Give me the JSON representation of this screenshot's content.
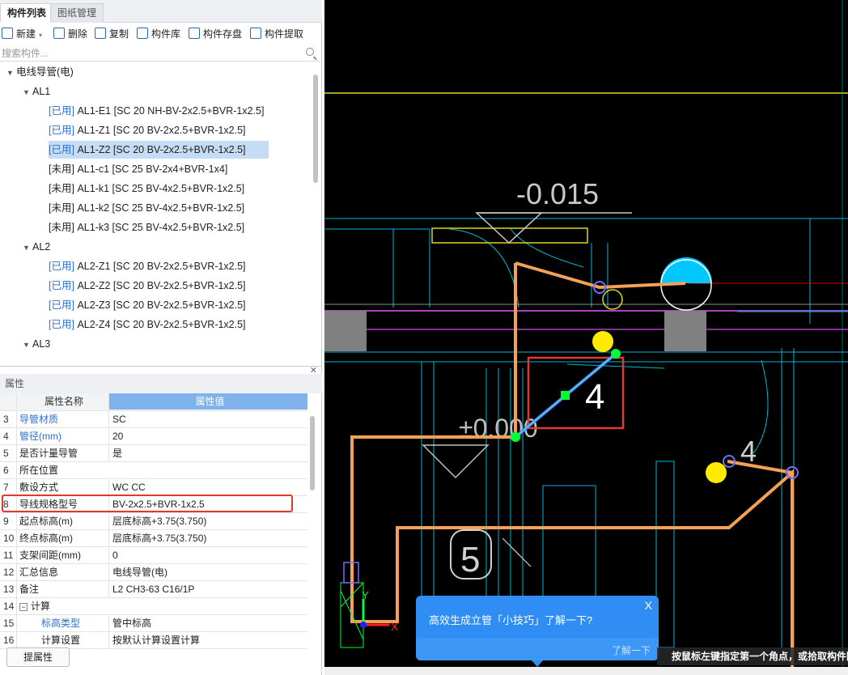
{
  "tabs": [
    "构件列表",
    "图纸管理"
  ],
  "toolbar": {
    "new": "新建",
    "delete": "删除",
    "copy": "复制",
    "library": "构件库",
    "save": "构件存盘",
    "extract": "构件提取"
  },
  "search": {
    "placeholder": "搜索构件..."
  },
  "tree": {
    "root": "电线导管(电)",
    "groups": [
      {
        "name": "AL1",
        "items": [
          {
            "tag": "[已用]",
            "text": "AL1-E1 [SC 20 NH-BV-2x2.5+BVR-1x2.5]"
          },
          {
            "tag": "[已用]",
            "text": "AL1-Z1 [SC 20 BV-2x2.5+BVR-1x2.5]"
          },
          {
            "tag": "[已用]",
            "text": "AL1-Z2 [SC 20 BV-2x2.5+BVR-1x2.5]"
          },
          {
            "tag": "[未用]",
            "text": "AL1-c1 [SC 25 BV-2x4+BVR-1x4]"
          },
          {
            "tag": "[未用]",
            "text": "AL1-k1 [SC 25 BV-4x2.5+BVR-1x2.5]"
          },
          {
            "tag": "[未用]",
            "text": "AL1-k2 [SC 25 BV-4x2.5+BVR-1x2.5]"
          },
          {
            "tag": "[未用]",
            "text": "AL1-k3 [SC 25 BV-4x2.5+BVR-1x2.5]"
          }
        ]
      },
      {
        "name": "AL2",
        "items": [
          {
            "tag": "[已用]",
            "text": "AL2-Z1 [SC 20 BV-2x2.5+BVR-1x2.5]"
          },
          {
            "tag": "[已用]",
            "text": "AL2-Z2 [SC 20 BV-2x2.5+BVR-1x2.5]"
          },
          {
            "tag": "[已用]",
            "text": "AL2-Z3 [SC 20 BV-2x2.5+BVR-1x2.5]"
          },
          {
            "tag": "[已用]",
            "text": "AL2-Z4 [SC 20 BV-2x2.5+BVR-1x2.5]"
          }
        ]
      },
      {
        "name": "AL3",
        "items": []
      }
    ]
  },
  "props": {
    "title": "属性",
    "col_name": "属性名称",
    "col_value": "属性值",
    "rows": [
      {
        "n": "3",
        "k": "导管材质",
        "v": "SC",
        "blue": true
      },
      {
        "n": "4",
        "k": "管径(mm)",
        "v": "20",
        "blue": true
      },
      {
        "n": "5",
        "k": "是否计量导管",
        "v": "是",
        "blue": false
      },
      {
        "n": "6",
        "k": "所在位置",
        "v": "",
        "blue": false
      },
      {
        "n": "7",
        "k": "敷设方式",
        "v": "WC CC",
        "blue": false
      },
      {
        "n": "8",
        "k": "导线规格型号",
        "v": "BV-2x2.5+BVR-1x2.5",
        "blue": false
      },
      {
        "n": "9",
        "k": "起点标高(m)",
        "v": "层底标高+3.75(3.750)",
        "blue": false
      },
      {
        "n": "10",
        "k": "终点标高(m)",
        "v": "层底标高+3.75(3.750)",
        "blue": false
      },
      {
        "n": "11",
        "k": "支架间距(mm)",
        "v": "0",
        "blue": false
      },
      {
        "n": "12",
        "k": "汇总信息",
        "v": "电线导管(电)",
        "blue": false
      },
      {
        "n": "13",
        "k": "备注",
        "v": "L2 CH3-63 C16/1P",
        "blue": false
      },
      {
        "n": "14",
        "k": "计算",
        "v": "",
        "blue": false,
        "expand": true
      },
      {
        "n": "15",
        "k": "标高类型",
        "v": "管中标高",
        "blue": true,
        "indent": true
      },
      {
        "n": "16",
        "k": "计算设置",
        "v": "按默认计算设置计算",
        "blue": false,
        "indent": true
      }
    ]
  },
  "bottom_button": "提属性",
  "cad": {
    "label_elev": "-0.015",
    "label_elev2": "±0.000",
    "label_4a": "4",
    "label_4b": "4",
    "label_5": "5",
    "axis_x": "X",
    "axis_y": "Y"
  },
  "popup": {
    "text": "高效生成立管「小技巧」了解一下?",
    "link": "了解一下",
    "close": "X"
  },
  "status": "按鼠标左键指定第一个角点，或拾取构件图元"
}
